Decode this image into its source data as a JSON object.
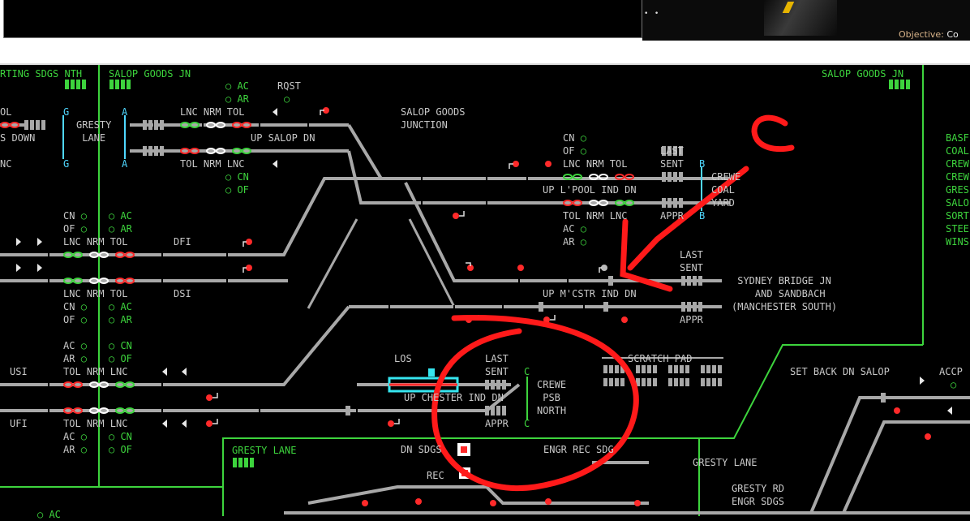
{
  "top": {
    "objective_label": "Objective:",
    "objective_value": "Co"
  },
  "areas": {
    "sorting_sdgs_nth": "RTING SDGS NTH",
    "salop_goods_jn_left": "SALOP GOODS JN",
    "salop_goods_jn_right": "SALOP GOODS JN",
    "gresty_lane_panel": "GRESTY LANE"
  },
  "labels": {
    "salop_goods_junction": "SALOP GOODS\nJUNCTION",
    "gresty_lane_box": "GRESTY\nLANE",
    "rqst": "RQST",
    "last_sent_top": "LAST\nSENT",
    "last_sent_mid": "LAST\nSENT",
    "last_sent_low": "LAST\nSENT",
    "appr_top": "APPR",
    "appr_mid": "APPR",
    "appr_low": "APPR",
    "crewe_coal_yard": "CREWE\nCOAL\nYARD",
    "sydney_bridge": "SYDNEY BRIDGE JN\n  AND SANDBACH\n(MANCHESTER SOUTH)",
    "crewe_psb_north": "CREWE\n PSB\nNORTH",
    "scratch_pad": "SCRATCH PAD",
    "set_back_dn_salop": "SET BACK DN SALOP",
    "accp": "ACCP",
    "los": "LOS",
    "dfi": "DFI",
    "dsi": "DSI",
    "usi": "USI",
    "ufi": "UFI",
    "dn_sdgs": "DN SDGS",
    "rec": "REC",
    "engr_rec_sdg": "ENGR REC SDG",
    "gresty_lane_right": "GRESTY LANE",
    "gresty_rd_engr_sdgs": "GRESTY RD\nENGR SDGS",
    "down_line": "S DOWN",
    "up_salop_dn": "UP SALOP DN",
    "up_lpool_ind_dn": "UP L'POOL IND DN",
    "up_mcstr_ind_dn": "UP M'CSTR IND DN",
    "up_chester_ind_dn": "UP CHESTER IND DN",
    "lnc_nrm_tol": "LNC NRM TOL",
    "tol_nrm_lnc": "TOL NRM LNC",
    "ol": "OL",
    "nc": "NC",
    "cn": "CN",
    "of": "OF",
    "ac": "AC",
    "ar": "AR",
    "g": "G",
    "a": "A",
    "b": "B",
    "c": "C"
  },
  "sidebar_list": [
    "BASF",
    "COAL",
    "CREW",
    "CREW",
    "GRES",
    "SALO",
    "SORT",
    "STEE",
    "WINS"
  ],
  "annotation": {
    "letter": "C",
    "color": "#ff1a1a"
  },
  "colors": {
    "track": "#a8a8a8",
    "text": "#c8c8c8",
    "area_text": "#3dd43d",
    "signal_red": "#ff1a1a",
    "highlight": "#36e6f0",
    "background": "#000000"
  }
}
